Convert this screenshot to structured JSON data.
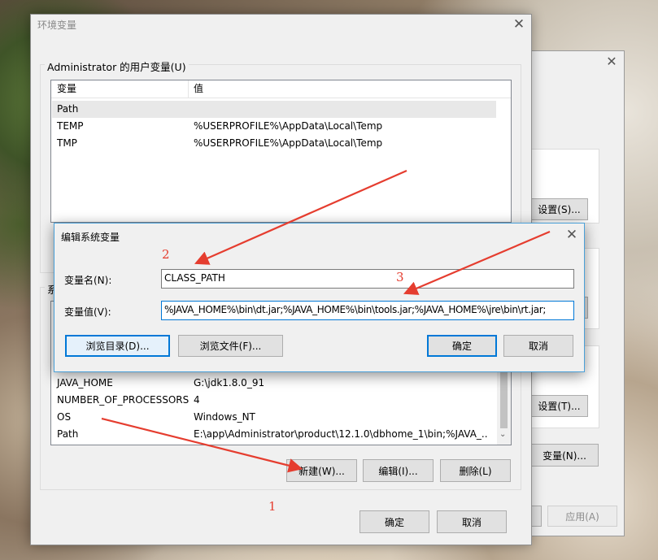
{
  "env_dialog": {
    "title": "环境变量",
    "user_group_label": "Administrator 的用户变量(U)",
    "user_columns": [
      "变量",
      "值"
    ],
    "user_rows": [
      {
        "name": "Path",
        "value": ""
      },
      {
        "name": "TEMP",
        "value": "%USERPROFILE%\\AppData\\Local\\Temp"
      },
      {
        "name": "TMP",
        "value": "%USERPROFILE%\\AppData\\Local\\Temp"
      }
    ],
    "system_group_label": "系",
    "system_rows": [
      {
        "name": "JAVA_HOME",
        "value": "G:\\jdk1.8.0_91"
      },
      {
        "name": "NUMBER_OF_PROCESSORS",
        "value": "4"
      },
      {
        "name": "OS",
        "value": "Windows_NT"
      },
      {
        "name": "Path",
        "value": "E:\\app\\Administrator\\product\\12.1.0\\dbhome_1\\bin;%JAVA_..."
      }
    ],
    "new_button": "新建(W)...",
    "edit_button": "编辑(I)...",
    "delete_button": "删除(L)",
    "ok_button": "确定",
    "cancel_button": "取消"
  },
  "edit_dialog": {
    "title": "编辑系统变量",
    "name_label": "变量名(N):",
    "name_value": "CLASS_PATH",
    "value_label": "变量值(V):",
    "value_value": "%JAVA_HOME%\\bin\\dt.jar;%JAVA_HOME%\\bin\\tools.jar;%JAVA_HOME%\\jre\\bin\\rt.jar;",
    "browse_dir_button": "浏览目录(D)...",
    "browse_file_button": "浏览文件(F)...",
    "ok_button": "确定",
    "cancel_button": "取消"
  },
  "back_window": {
    "settings_button_1": "设置(S)...",
    "settings_button_2": "设置(T)...",
    "env_var_button": "变量(N)...",
    "apply_button": "应用(A)"
  },
  "annotations": {
    "step_1": "1",
    "step_2": "2",
    "step_3": "3",
    "color": "#e53d2f"
  }
}
